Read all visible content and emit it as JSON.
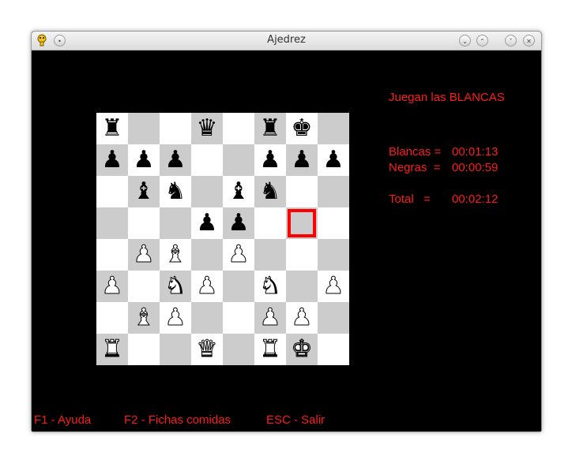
{
  "window": {
    "title": "Ajedrez"
  },
  "status": {
    "turn": "Juegan las BLANCAS",
    "white_label": "Blancas =",
    "white_time": "00:01:13",
    "black_label": "Negras  =",
    "black_time": "00:00:59",
    "total_label": "Total   =",
    "total_time": "00:02:12"
  },
  "footer": {
    "help": "F1 - Ayuda",
    "captured": "F2 - Fichas comidas",
    "quit": "ESC - Salir"
  },
  "colors": {
    "text": "#ff1a1a",
    "dark_square": "#cccccc",
    "light_square": "#ffffff",
    "highlight": "#ff0000"
  },
  "board": {
    "rows": [
      [
        "bR",
        "",
        "",
        "bQ",
        "",
        "bR",
        "bK",
        ""
      ],
      [
        "bP",
        "bP",
        "bP",
        "",
        "",
        "bP",
        "bP",
        "bP"
      ],
      [
        "",
        "bB",
        "bN",
        "",
        "bB",
        "bN",
        "",
        ""
      ],
      [
        "",
        "",
        "",
        "bP",
        "bP",
        "",
        "",
        ""
      ],
      [
        "",
        "wP",
        "wB",
        "",
        "wP",
        "",
        "",
        ""
      ],
      [
        "wP",
        "",
        "wN",
        "wP",
        "",
        "wN",
        "",
        "wP"
      ],
      [
        "",
        "wB",
        "wP",
        "",
        "",
        "wP",
        "wP",
        ""
      ],
      [
        "wR",
        "",
        "",
        "wQ",
        "",
        "wR",
        "wK",
        ""
      ]
    ],
    "selected": {
      "row": 3,
      "col": 6
    }
  },
  "piece_icons": {
    "K": "♚",
    "Q": "♛",
    "R": "♜",
    "B": "♝",
    "N": "♞",
    "P": "♟"
  }
}
